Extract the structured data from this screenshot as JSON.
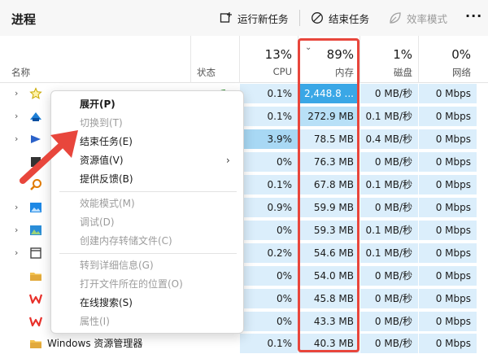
{
  "toolbar": {
    "title": "进程",
    "run_task": "运行新任务",
    "end_task": "结束任务",
    "efficiency_mode": "效率模式",
    "more": "···"
  },
  "columns": {
    "name": "名称",
    "status": "状态",
    "cpu": {
      "percent": "13%",
      "label": "CPU"
    },
    "memory": {
      "percent": "89%",
      "label": "内存"
    },
    "disk": {
      "percent": "1%",
      "label": "磁盘"
    },
    "network": {
      "percent": "0%",
      "label": "网络"
    }
  },
  "rows": [
    {
      "name": "",
      "cpu": "0.1%",
      "memory": "2,448.8 ...",
      "disk": "0 MB/秒",
      "network": "0 Mbps"
    },
    {
      "name": "",
      "cpu": "0.1%",
      "memory": "272.9 MB",
      "disk": "0.1 MB/秒",
      "network": "0 Mbps"
    },
    {
      "name": "",
      "cpu": "3.9%",
      "memory": "78.5 MB",
      "disk": "0.4 MB/秒",
      "network": "0 Mbps"
    },
    {
      "name": "",
      "cpu": "0%",
      "memory": "76.3 MB",
      "disk": "0 MB/秒",
      "network": "0 Mbps"
    },
    {
      "name": "",
      "cpu": "0.1%",
      "memory": "67.8 MB",
      "disk": "0.1 MB/秒",
      "network": "0 Mbps"
    },
    {
      "name": "",
      "cpu": "0.9%",
      "memory": "59.9 MB",
      "disk": "0 MB/秒",
      "network": "0 Mbps"
    },
    {
      "name": "",
      "cpu": "0%",
      "memory": "59.3 MB",
      "disk": "0.1 MB/秒",
      "network": "0 Mbps"
    },
    {
      "name": "",
      "cpu": "0.2%",
      "memory": "54.6 MB",
      "disk": "0.1 MB/秒",
      "network": "0 Mbps"
    },
    {
      "name": "",
      "cpu": "0%",
      "memory": "54.0 MB",
      "disk": "0 MB/秒",
      "network": "0 Mbps"
    },
    {
      "name": "",
      "cpu": "0%",
      "memory": "45.8 MB",
      "disk": "0 MB/秒",
      "network": "0 Mbps"
    },
    {
      "name": "",
      "cpu": "0%",
      "memory": "43.3 MB",
      "disk": "0 MB/秒",
      "network": "0 Mbps"
    },
    {
      "name": "Windows 资源管理器",
      "cpu": "0.1%",
      "memory": "40.3 MB",
      "disk": "0 MB/秒",
      "network": "0 Mbps"
    }
  ],
  "context_menu": {
    "expand": "展开(P)",
    "switch_to": "切换到(T)",
    "end_task": "结束任务(E)",
    "resource_values": "资源值(V)",
    "feedback": "提供反馈(B)",
    "efficiency_mode": "效能模式(M)",
    "debug": "调试(D)",
    "create_dump": "创建内存转储文件(C)",
    "go_to_details": "转到详细信息(G)",
    "open_file_location": "打开文件所在的位置(O)",
    "search_online": "在线搜索(S)",
    "properties": "属性(I)"
  },
  "colors": {
    "highlight": "#e8463c",
    "cell": "#dbeefb",
    "memory_hot": "#3aa7e6"
  }
}
